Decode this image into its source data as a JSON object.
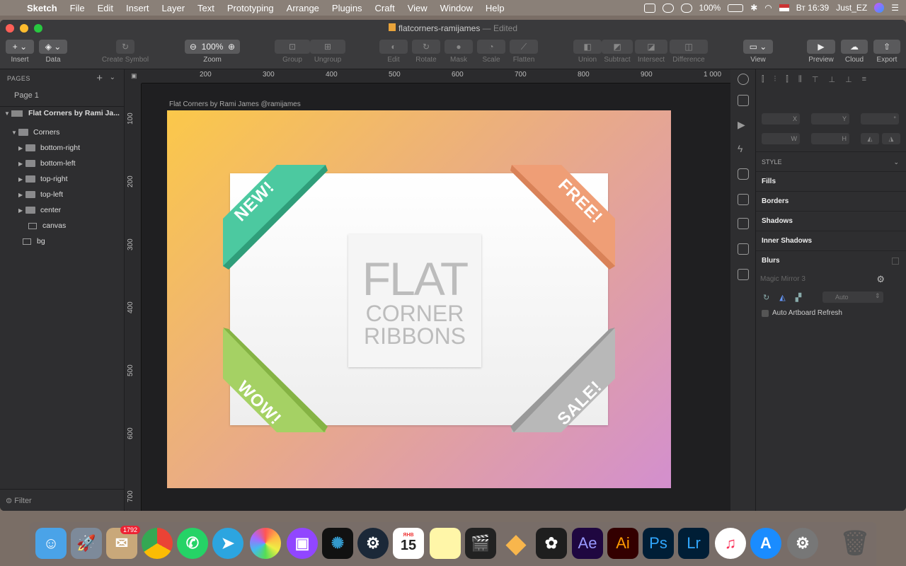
{
  "menubar": {
    "app": "Sketch",
    "items": [
      "File",
      "Edit",
      "Insert",
      "Layer",
      "Text",
      "Prototyping",
      "Arrange",
      "Plugins",
      "Craft",
      "View",
      "Window",
      "Help"
    ],
    "battery": "100%",
    "clock": "Вт 16:39",
    "user": "Just_EZ"
  },
  "window": {
    "title": "flatcorners-ramijames",
    "edited": "— Edited"
  },
  "toolbar": {
    "insert": "Insert",
    "data": "Data",
    "create_symbol": "Create Symbol",
    "zoom_value": "100%",
    "zoom": "Zoom",
    "group": "Group",
    "ungroup": "Ungroup",
    "edit": "Edit",
    "rotate": "Rotate",
    "mask": "Mask",
    "scale": "Scale",
    "flatten": "Flatten",
    "union": "Union",
    "subtract": "Subtract",
    "intersect": "Intersect",
    "difference": "Difference",
    "view": "View",
    "preview": "Preview",
    "cloud": "Cloud",
    "export": "Export"
  },
  "sidebar": {
    "pages_header": "PAGES",
    "page": "Page 1",
    "artboard": "Flat Corners by Rami Ja...",
    "group": "Corners",
    "layers": [
      "bottom-right",
      "bottom-left",
      "top-right",
      "top-left",
      "center"
    ],
    "canvas_layer": "canvas",
    "bg_layer": "bg",
    "filter": "Filter"
  },
  "rulers": {
    "top": [
      "200",
      "300",
      "400",
      "500",
      "600",
      "700",
      "800",
      "900",
      "1 000"
    ],
    "left": [
      "100",
      "200",
      "300",
      "400",
      "500",
      "600",
      "700"
    ]
  },
  "canvas": {
    "artboard_label": "Flat Corners by Rami James @ramijames",
    "center_line1": "FLAT",
    "center_line2": "CORNER",
    "center_line3": "RIBBONS",
    "ribbons": {
      "top_left": "NEW!",
      "top_right": "FREE!",
      "bottom_left": "WOW!",
      "bottom_right": "SALE!"
    },
    "colors": {
      "new": "#4cc9a0",
      "free": "#ef9e76",
      "wow": "#a5d164",
      "sale": "#b8b8b8"
    }
  },
  "inspector": {
    "x": "X",
    "y": "Y",
    "angle": "°",
    "w": "W",
    "h": "H",
    "style": "STYLE",
    "fills": "Fills",
    "borders": "Borders",
    "shadows": "Shadows",
    "inner_shadows": "Inner Shadows",
    "blurs": "Blurs",
    "plugin": "Magic Mirror 3",
    "auto": "Auto",
    "auto_refresh": "Auto Artboard Refresh"
  },
  "dock": {
    "badge": "1792",
    "calendar_month": "ЯНВ",
    "calendar_day": "15"
  }
}
